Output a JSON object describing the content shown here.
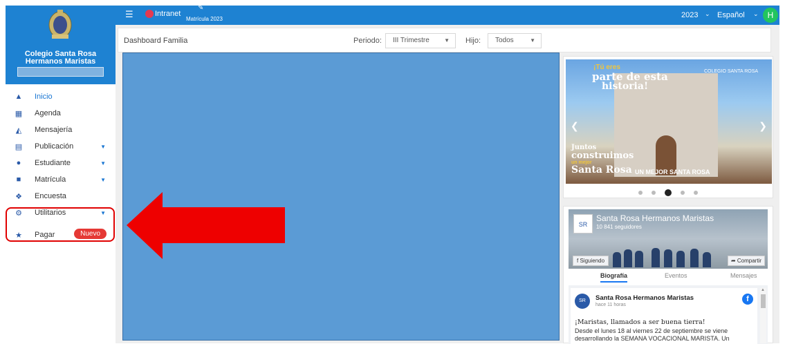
{
  "sidebar": {
    "school_name": "Colegio Santa Rosa Hermanos Maristas",
    "menu": [
      {
        "label": "Inicio",
        "icon": "home-icon"
      },
      {
        "label": "Agenda",
        "icon": "calendar-icon"
      },
      {
        "label": "Mensajería",
        "icon": "message-icon"
      },
      {
        "label": "Publicación",
        "icon": "publication-icon"
      },
      {
        "label": "Estudiante",
        "icon": "student-icon"
      },
      {
        "label": "Matrícula",
        "icon": "book-icon"
      },
      {
        "label": "Encuesta",
        "icon": "survey-icon"
      },
      {
        "label": "Utilitarios",
        "icon": "tools-icon"
      },
      {
        "label": "Pagar",
        "icon": "payment-icon",
        "badge": "Nuevo"
      }
    ]
  },
  "topbar": {
    "intranet": "Intranet",
    "matricula": "Matrícula 2023",
    "year": "2023",
    "language": "Español",
    "avatar_letter": "H"
  },
  "dashboard": {
    "title": "Dashboard Familia",
    "periodo_label": "Periodo:",
    "periodo_value": "III Trimestre",
    "hijo_label": "Hijo:",
    "hijo_value": "Todos"
  },
  "carousel": {
    "line1": "¡Tú eres",
    "line2": "parte de esta",
    "line3": "historia!",
    "line4": "Juntos",
    "line5": "construimos",
    "line6": "un mejor",
    "line7": "Santa Rosa",
    "line8": "UN MEJOR SANTA ROSA",
    "logo_text": "COLEGIO SANTA ROSA"
  },
  "facebook": {
    "page_name": "Santa Rosa Hermanos Maristas",
    "followers": "10 841 seguidores",
    "follow_btn": "Siguiendo",
    "share_btn": "Compartir",
    "tabs": [
      "Biografía",
      "Eventos",
      "Mensajes"
    ],
    "post_author": "Santa Rosa Hermanos Maristas",
    "post_time": "hace 11 horas",
    "post_title": "¡Maristas, llamados a ser buena tierra!",
    "post_text": "Desde el lunes 18 al viernes 22 de septiembre se viene desarrollando la SEMANA VOCACIONAL MARISTA. Un"
  },
  "colors": {
    "primary": "#1e82d2",
    "highlight": "#e00000",
    "badge": "#e53935"
  }
}
